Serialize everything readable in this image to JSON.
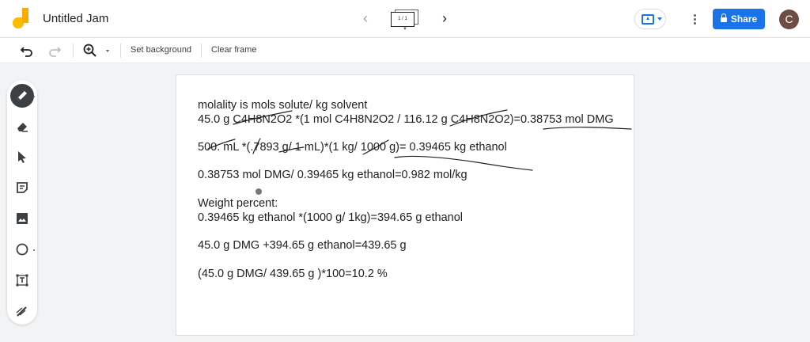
{
  "app": {
    "title": "Untitled Jam",
    "frame_counter": "1 / 1",
    "share_label": "Share",
    "avatar_initial": "C",
    "accent": "#1a73e8",
    "avatar_color": "#6d4c41"
  },
  "toolbar": {
    "set_background": "Set background",
    "clear_frame": "Clear frame"
  },
  "tools": [
    {
      "name": "pen",
      "icon": "pen-icon",
      "active": true
    },
    {
      "name": "eraser",
      "icon": "eraser-icon"
    },
    {
      "name": "select",
      "icon": "select-arrow-icon"
    },
    {
      "name": "sticky-note",
      "icon": "sticky-note-icon"
    },
    {
      "name": "image",
      "icon": "image-icon"
    },
    {
      "name": "shape",
      "icon": "circle-icon"
    },
    {
      "name": "text-box",
      "icon": "text-box-icon"
    },
    {
      "name": "laser",
      "icon": "laser-icon"
    }
  ],
  "canvas": {
    "lines": [
      "molality is mols solute/ kg solvent",
      "45.0 g C4H8N2O2 *(1 mol  C4H8N2O2 / 116.12 g C4H8N2O2)=0.38753 mol DMG",
      "500. mL *(.7893 g/ 1 mL)*(1 kg/ 1000 g)= 0.39465 kg ethanol",
      "0.38753 mol DMG/ 0.39465 kg ethanol=0.982 mol/kg",
      "Weight percent:",
      "0.39465 kg ethanol *(1000 g/ 1kg)=394.65 g ethanol",
      "45.0 g DMG +394.65 g ethanol=439.65 g",
      "(45.0 g DMG/ 439.65 g )*100=10.2 %"
    ]
  }
}
